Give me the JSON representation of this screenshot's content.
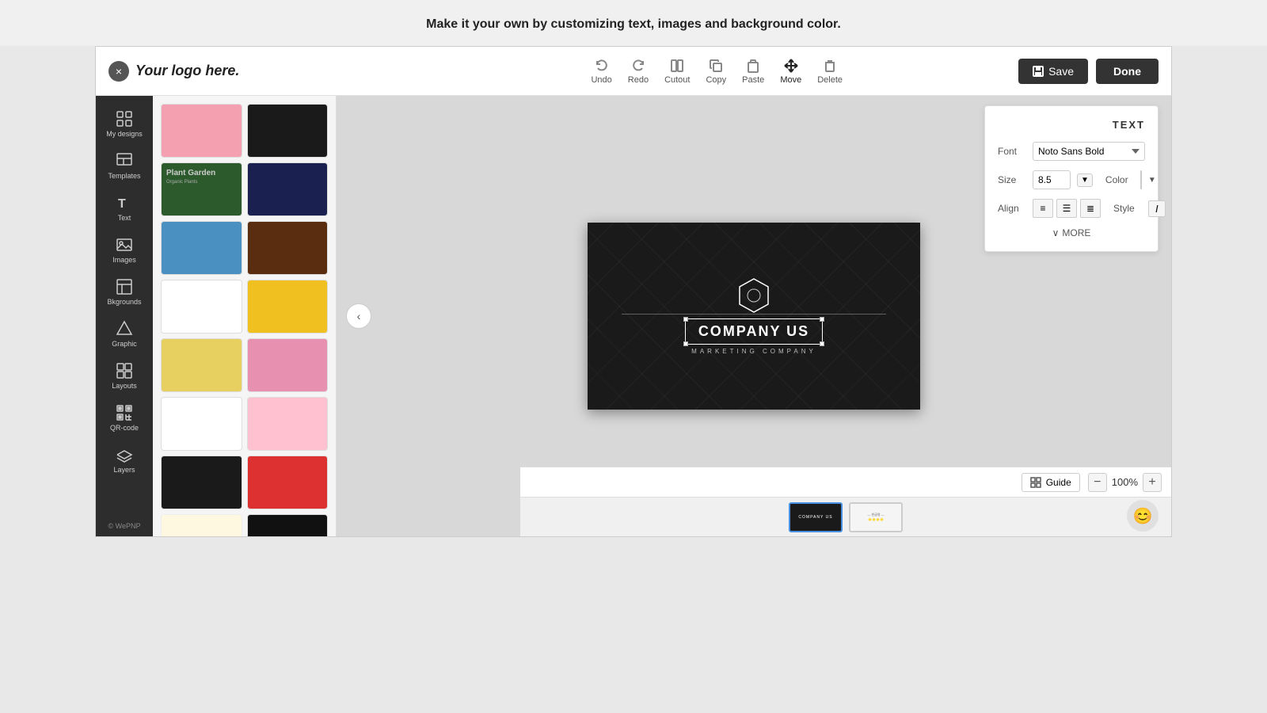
{
  "banner": {
    "text": "Make it your own by customizing text, images and background color."
  },
  "logo": {
    "close_icon": "×",
    "text": "Your logo here."
  },
  "toolbar": {
    "tools": [
      {
        "id": "undo",
        "label": "Undo",
        "icon": "undo"
      },
      {
        "id": "redo",
        "label": "Redo",
        "icon": "redo"
      },
      {
        "id": "cutout",
        "label": "Cutout",
        "icon": "cutout"
      },
      {
        "id": "copy",
        "label": "Copy",
        "icon": "copy"
      },
      {
        "id": "paste",
        "label": "Paste",
        "icon": "paste"
      },
      {
        "id": "move",
        "label": "Move",
        "icon": "move",
        "active": true
      },
      {
        "id": "delete",
        "label": "Delete",
        "icon": "delete"
      }
    ],
    "save_label": "Save",
    "done_label": "Done"
  },
  "sidebar": {
    "items": [
      {
        "id": "my-designs",
        "label": "My designs",
        "icon": "grid"
      },
      {
        "id": "templates",
        "label": "Templates",
        "icon": "templates"
      },
      {
        "id": "text",
        "label": "Text",
        "icon": "text"
      },
      {
        "id": "images",
        "label": "Images",
        "icon": "images"
      },
      {
        "id": "backgrounds",
        "label": "Bkgrounds",
        "icon": "backgrounds"
      },
      {
        "id": "graphic",
        "label": "Graphic",
        "icon": "graphic"
      },
      {
        "id": "layouts",
        "label": "Layouts",
        "icon": "layouts"
      },
      {
        "id": "qr-code",
        "label": "QR-code",
        "icon": "qr"
      },
      {
        "id": "layers",
        "label": "Layers",
        "icon": "layers"
      }
    ],
    "footer": "© WePNP"
  },
  "canvas": {
    "company_name": "COMPANY US",
    "subtitle": "MARKETING COMPANY"
  },
  "text_panel": {
    "title": "TEXT",
    "font_label": "Font",
    "font_value": "Noto Sans Bold",
    "size_label": "Size",
    "size_value": "8.5",
    "color_label": "Color",
    "align_label": "Align",
    "style_label": "Style",
    "more_label": "MORE"
  },
  "bottom": {
    "guide_label": "Guide",
    "zoom_level": "100%",
    "zoom_minus": "−",
    "zoom_plus": "+"
  },
  "templates": [
    {
      "id": 1,
      "bg": "#f5a0b0"
    },
    {
      "id": 2,
      "bg": "#1a1a1a"
    },
    {
      "id": 3,
      "bg": "#2d5a2d"
    },
    {
      "id": 4,
      "bg": "#1a2050"
    },
    {
      "id": 5,
      "bg": "#5090c0"
    },
    {
      "id": 6,
      "bg": "#5a2d10"
    },
    {
      "id": 7,
      "bg": "#ffffff"
    },
    {
      "id": 8,
      "bg": "#f0c020"
    },
    {
      "id": 9,
      "bg": "#e8d060"
    },
    {
      "id": 10,
      "bg": "#e890b0"
    },
    {
      "id": 11,
      "bg": "#ffffff"
    },
    {
      "id": 12,
      "bg": "#ffc0d0"
    },
    {
      "id": 13,
      "bg": "#222222"
    },
    {
      "id": 14,
      "bg": "#dd3030"
    },
    {
      "id": 15,
      "bg": "#fff8e0"
    },
    {
      "id": 16,
      "bg": "#111111"
    },
    {
      "id": 17,
      "bg": "#e8f8e8"
    }
  ]
}
